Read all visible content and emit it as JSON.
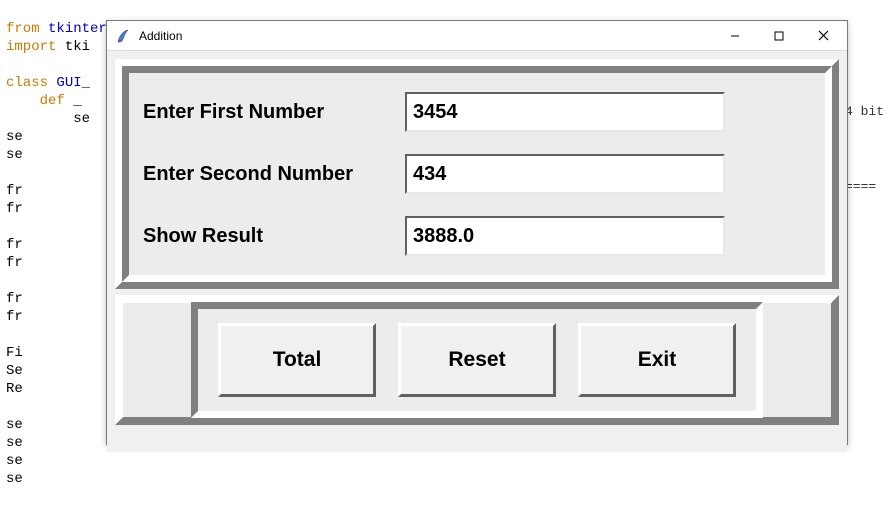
{
  "code": {
    "line1_from": "from",
    "line1_import": "import",
    "line1_mod": "tkinter",
    "line1_rest": "*",
    "line2_import": "import",
    "line2_rest": "tki",
    "line4_class": "class",
    "line4_name": "GUI_",
    "line5_def": "def",
    "line5_rest": "_",
    "indent_lines": "se\nse\nse\n\nfr\nfr\n\nfr\nfr\n\nfr\nfr\n\nFi\nSe\nRe\n\nse\nse\nse\nse"
  },
  "console_snip": "4 bit\n\n\n\n\n====",
  "window": {
    "title": "Addition",
    "form": {
      "label1": "Enter First Number",
      "value1": "3454",
      "label2": "Enter Second Number",
      "value2": "434",
      "label3": "Show Result",
      "value3": "3888.0"
    },
    "buttons": {
      "total": "Total",
      "reset": "Reset",
      "exit": "Exit"
    }
  }
}
